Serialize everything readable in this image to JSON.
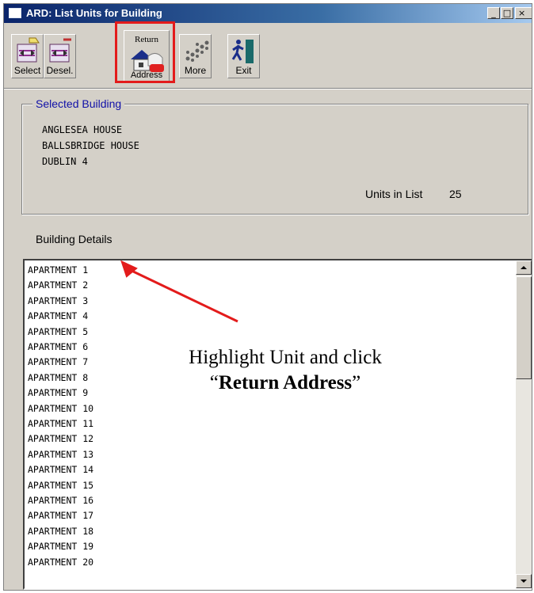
{
  "window": {
    "title": "ARD: List Units for Building",
    "controls": {
      "minimize": "_",
      "maximize": "□",
      "close": "×"
    }
  },
  "toolbar": {
    "select_label": "Select",
    "deselect_label": "Desel.",
    "return_label_top": "Return",
    "return_label_bottom": "Address",
    "more_label": "More",
    "exit_label": "Exit"
  },
  "selected_building": {
    "legend": "Selected Building",
    "address_lines": [
      "ANGLESEA HOUSE",
      "BALLSBRIDGE HOUSE",
      "DUBLIN 4"
    ],
    "units_label": "Units in List",
    "units_value": "25"
  },
  "building_details": {
    "title": "Building Details",
    "units": [
      "APARTMENT 1",
      "APARTMENT 2",
      "APARTMENT 3",
      "APARTMENT 4",
      "APARTMENT 5",
      "APARTMENT 6",
      "APARTMENT 7",
      "APARTMENT 8",
      "APARTMENT 9",
      "APARTMENT 10",
      "APARTMENT 11",
      "APARTMENT 12",
      "APARTMENT 13",
      "APARTMENT 14",
      "APARTMENT 15",
      "APARTMENT 16",
      "APARTMENT 17",
      "APARTMENT 18",
      "APARTMENT 19",
      "APARTMENT 20"
    ]
  },
  "annotation": {
    "line1": "Highlight Unit and click",
    "quote_open": "“",
    "emphasis": "Return Address",
    "quote_close": "”"
  },
  "colors": {
    "highlight": "#e31b1b",
    "legend": "#1010a8",
    "title_bar": "#0a246a"
  }
}
